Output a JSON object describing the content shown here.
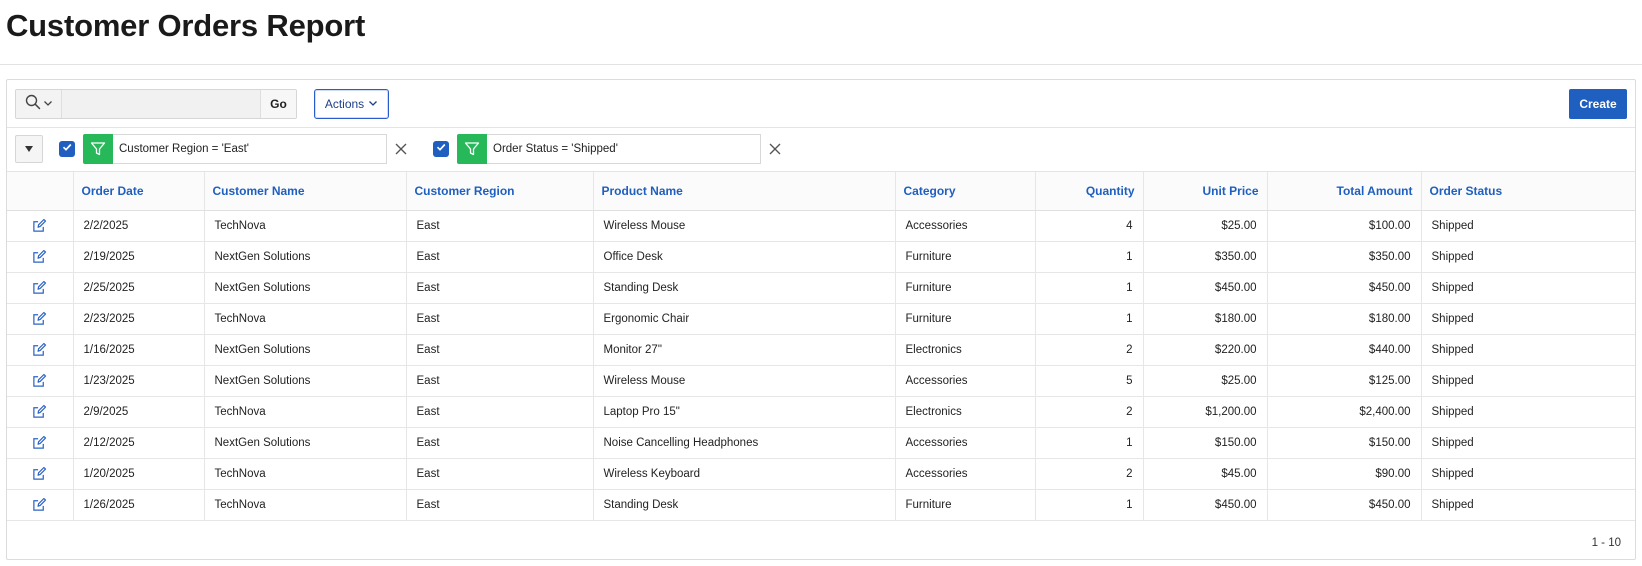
{
  "page": {
    "title": "Customer Orders Report"
  },
  "toolbar": {
    "search_value": "",
    "search_placeholder": "",
    "go_label": "Go",
    "actions_label": "Actions",
    "create_label": "Create"
  },
  "filters": [
    {
      "label": "Customer Region = 'East'",
      "checked": true
    },
    {
      "label": "Order Status = 'Shipped'",
      "checked": true
    }
  ],
  "colors": {
    "accent": "#1f5fbf",
    "filter_badge": "#27b85a"
  },
  "table": {
    "columns": [
      "Order Date",
      "Customer Name",
      "Customer Region",
      "Product Name",
      "Category",
      "Quantity",
      "Unit Price",
      "Total Amount",
      "Order Status"
    ],
    "rows": [
      [
        "2/2/2025",
        "TechNova",
        "East",
        "Wireless Mouse",
        "Accessories",
        "4",
        "$25.00",
        "$100.00",
        "Shipped"
      ],
      [
        "2/19/2025",
        "NextGen Solutions",
        "East",
        "Office Desk",
        "Furniture",
        "1",
        "$350.00",
        "$350.00",
        "Shipped"
      ],
      [
        "2/25/2025",
        "NextGen Solutions",
        "East",
        "Standing Desk",
        "Furniture",
        "1",
        "$450.00",
        "$450.00",
        "Shipped"
      ],
      [
        "2/23/2025",
        "TechNova",
        "East",
        "Ergonomic Chair",
        "Furniture",
        "1",
        "$180.00",
        "$180.00",
        "Shipped"
      ],
      [
        "1/16/2025",
        "NextGen Solutions",
        "East",
        "Monitor 27\"",
        "Electronics",
        "2",
        "$220.00",
        "$440.00",
        "Shipped"
      ],
      [
        "1/23/2025",
        "NextGen Solutions",
        "East",
        "Wireless Mouse",
        "Accessories",
        "5",
        "$25.00",
        "$125.00",
        "Shipped"
      ],
      [
        "2/9/2025",
        "TechNova",
        "East",
        "Laptop Pro 15\"",
        "Electronics",
        "2",
        "$1,200.00",
        "$2,400.00",
        "Shipped"
      ],
      [
        "2/12/2025",
        "NextGen Solutions",
        "East",
        "Noise Cancelling Headphones",
        "Accessories",
        "1",
        "$150.00",
        "$150.00",
        "Shipped"
      ],
      [
        "1/20/2025",
        "TechNova",
        "East",
        "Wireless Keyboard",
        "Accessories",
        "2",
        "$45.00",
        "$90.00",
        "Shipped"
      ],
      [
        "1/26/2025",
        "TechNova",
        "East",
        "Standing Desk",
        "Furniture",
        "1",
        "$450.00",
        "$450.00",
        "Shipped"
      ]
    ]
  },
  "pagination": {
    "range": "1 - 10"
  },
  "icons": {
    "search": "search-icon",
    "chevron": "chevron-down-icon",
    "collapse": "caret-down-icon",
    "checkbox": "checkmark-icon",
    "filter": "filter-funnel-icon",
    "remove": "close-icon",
    "edit": "edit-pencil-icon"
  }
}
